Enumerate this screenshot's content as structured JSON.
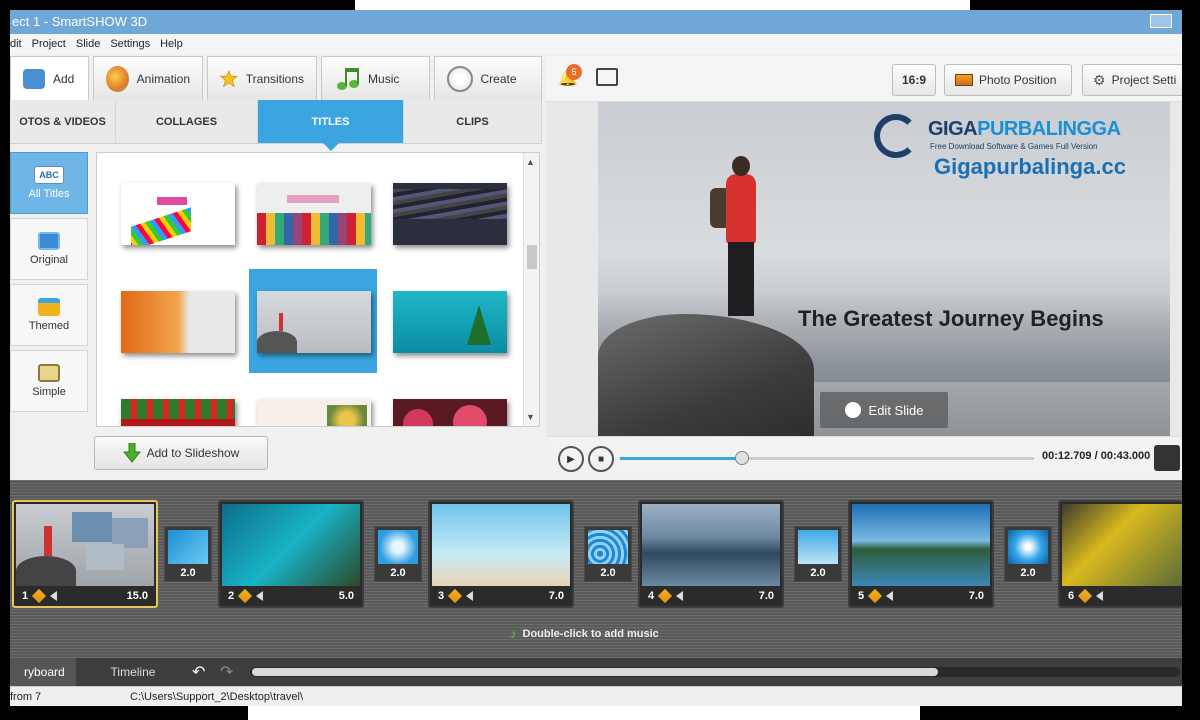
{
  "window": {
    "title": "ect 1 - SmartSHOW 3D"
  },
  "menu": [
    "dit",
    "Project",
    "Slide",
    "Settings",
    "Help"
  ],
  "maintabs": [
    {
      "label": "Add",
      "icon": "add-photo-icon"
    },
    {
      "label": "Animation",
      "icon": "palette-icon"
    },
    {
      "label": "Transitions",
      "icon": "star-icon"
    },
    {
      "label": "Music",
      "icon": "music-note-icon"
    },
    {
      "label": "Create",
      "icon": "film-reel-icon"
    }
  ],
  "subtabs": [
    "OTOS & VIDEOS",
    "COLLAGES",
    "TITLES",
    "CLIPS"
  ],
  "categories": [
    {
      "label": "All Titles",
      "icon": "abc-icon"
    },
    {
      "label": "Original",
      "icon": "monitor-icon"
    },
    {
      "label": "Themed",
      "icon": "gift-icon"
    },
    {
      "label": "Simple",
      "icon": "abc-box-icon"
    }
  ],
  "add_button": "Add to Slideshow",
  "preview_toolbar": {
    "notifications": "5",
    "ratio": "16:9",
    "photo_position": "Photo Position",
    "project_settings": "Project Setti"
  },
  "preview": {
    "slide_title": "The Greatest Journey Begins",
    "edit_slide": "Edit Slide",
    "watermark_brand_a": "GIGA",
    "watermark_brand_b": "PURBALINGGA",
    "watermark_tagline": "Free Download Software & Games Full Version",
    "watermark_url": "Gigapurbalinga.cc"
  },
  "playback": {
    "timecode": "00:12.709 / 00:43.000",
    "progress": 0.295
  },
  "slides": [
    {
      "num": "1",
      "dur": "15.0"
    },
    {
      "num": "2",
      "dur": "5.0"
    },
    {
      "num": "3",
      "dur": "7.0"
    },
    {
      "num": "4",
      "dur": "7.0"
    },
    {
      "num": "5",
      "dur": "7.0"
    },
    {
      "num": "6",
      "dur": ""
    }
  ],
  "transitions": [
    "2.0",
    "2.0",
    "2.0",
    "2.0",
    "2.0"
  ],
  "music_hint": "Double-click to add music",
  "bottomtabs": [
    "ryboard",
    "Timeline"
  ],
  "status": {
    "left": "from 7",
    "path": "C:\\Users\\Support_2\\Desktop\\travel\\"
  },
  "colors": {
    "accent": "#3aa5e0",
    "selection": "#e8c65a",
    "brand": "#1e3f6a"
  }
}
